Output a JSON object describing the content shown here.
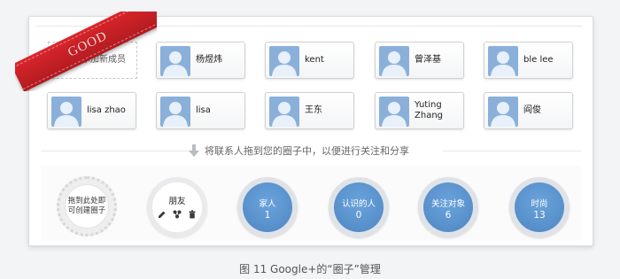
{
  "badge": "GOOD",
  "add_member": "添加新成员",
  "contacts": [
    {
      "name": "杨煜炜"
    },
    {
      "name": "kent"
    },
    {
      "name": "曾泽基"
    },
    {
      "name": "ble lee"
    },
    {
      "name": "lisa zhao"
    },
    {
      "name": "lisa"
    },
    {
      "name": "王东"
    },
    {
      "name": "Yuting Zhang"
    },
    {
      "name": "阎俊"
    }
  ],
  "hint": "将联系人拖到您的圈子中，以便进行关注和分享",
  "drop_circle": {
    "line1": "拖到此处即",
    "line2": "可创建圈子"
  },
  "friends_circle": {
    "label": "朋友"
  },
  "circles": [
    {
      "name": "家人",
      "count": "1"
    },
    {
      "name": "认识的人",
      "count": "0"
    },
    {
      "name": "关注对象",
      "count": "6"
    },
    {
      "name": "时尚",
      "count": "13"
    }
  ],
  "caption": "图 11  Google+的“圈子”管理",
  "colors": {
    "accent": "#5b95d0",
    "ribbon": "#c81f24",
    "avatar": "#8ab0da"
  }
}
